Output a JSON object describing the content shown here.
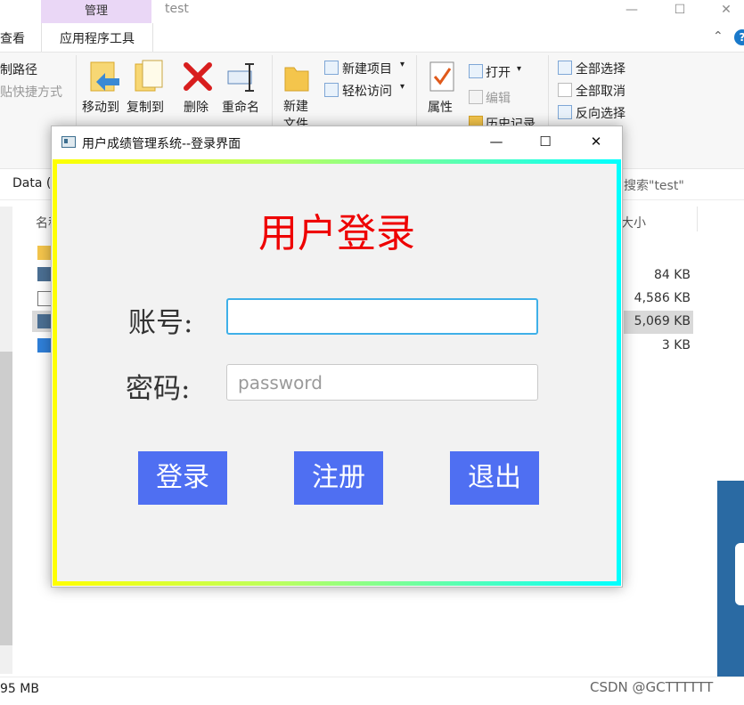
{
  "explorer": {
    "tab_manage": "管理",
    "tab_app_tools": "应用程序工具",
    "tab_view": "查看",
    "window_title": "test",
    "win_minimize": "—",
    "win_maximize": "☐",
    "win_close": "✕",
    "chevron": "⌃",
    "help": "?",
    "ribbon": {
      "copy_path": "制路径",
      "paste_shortcut": "贴快捷方式",
      "move_to": "移动到",
      "copy_to": "复制到",
      "delete": "删除",
      "rename": "重命名",
      "new_folder": "新建\n文件夹",
      "new_item": "新建项目",
      "easy_access": "轻松访问",
      "properties": "属性",
      "open": "打开",
      "edit": "编辑",
      "history": "历史记录",
      "select_all": "全部选择",
      "select_none": "全部取消",
      "invert_selection": "反向选择",
      "dropdown_arrow": "▾"
    },
    "address_text": "Data (I",
    "search_placeholder": "搜索\"test\"",
    "column_name": "名称",
    "column_size": "大小",
    "file_sizes": [
      "84 KB",
      "4,586 KB",
      "5,069 KB",
      "3 KB"
    ],
    "status_size": "95 MB"
  },
  "dialog": {
    "title": "用户成绩管理系统--登录界面",
    "ctl_minimize": "—",
    "ctl_maximize": "☐",
    "ctl_close": "✕",
    "heading": "用户登录",
    "account_label": "账号:",
    "account_value": "",
    "password_label": "密码:",
    "password_placeholder": "password",
    "login_button": "登录",
    "register_button": "注册",
    "exit_button": "退出"
  },
  "watermark": "CSDN @GCTTTTTT",
  "colors": {
    "heading": "#ee0000",
    "button": "#4f6ff2",
    "manage_tab": "#ead7f6",
    "focus_border": "#3fb0e8"
  }
}
